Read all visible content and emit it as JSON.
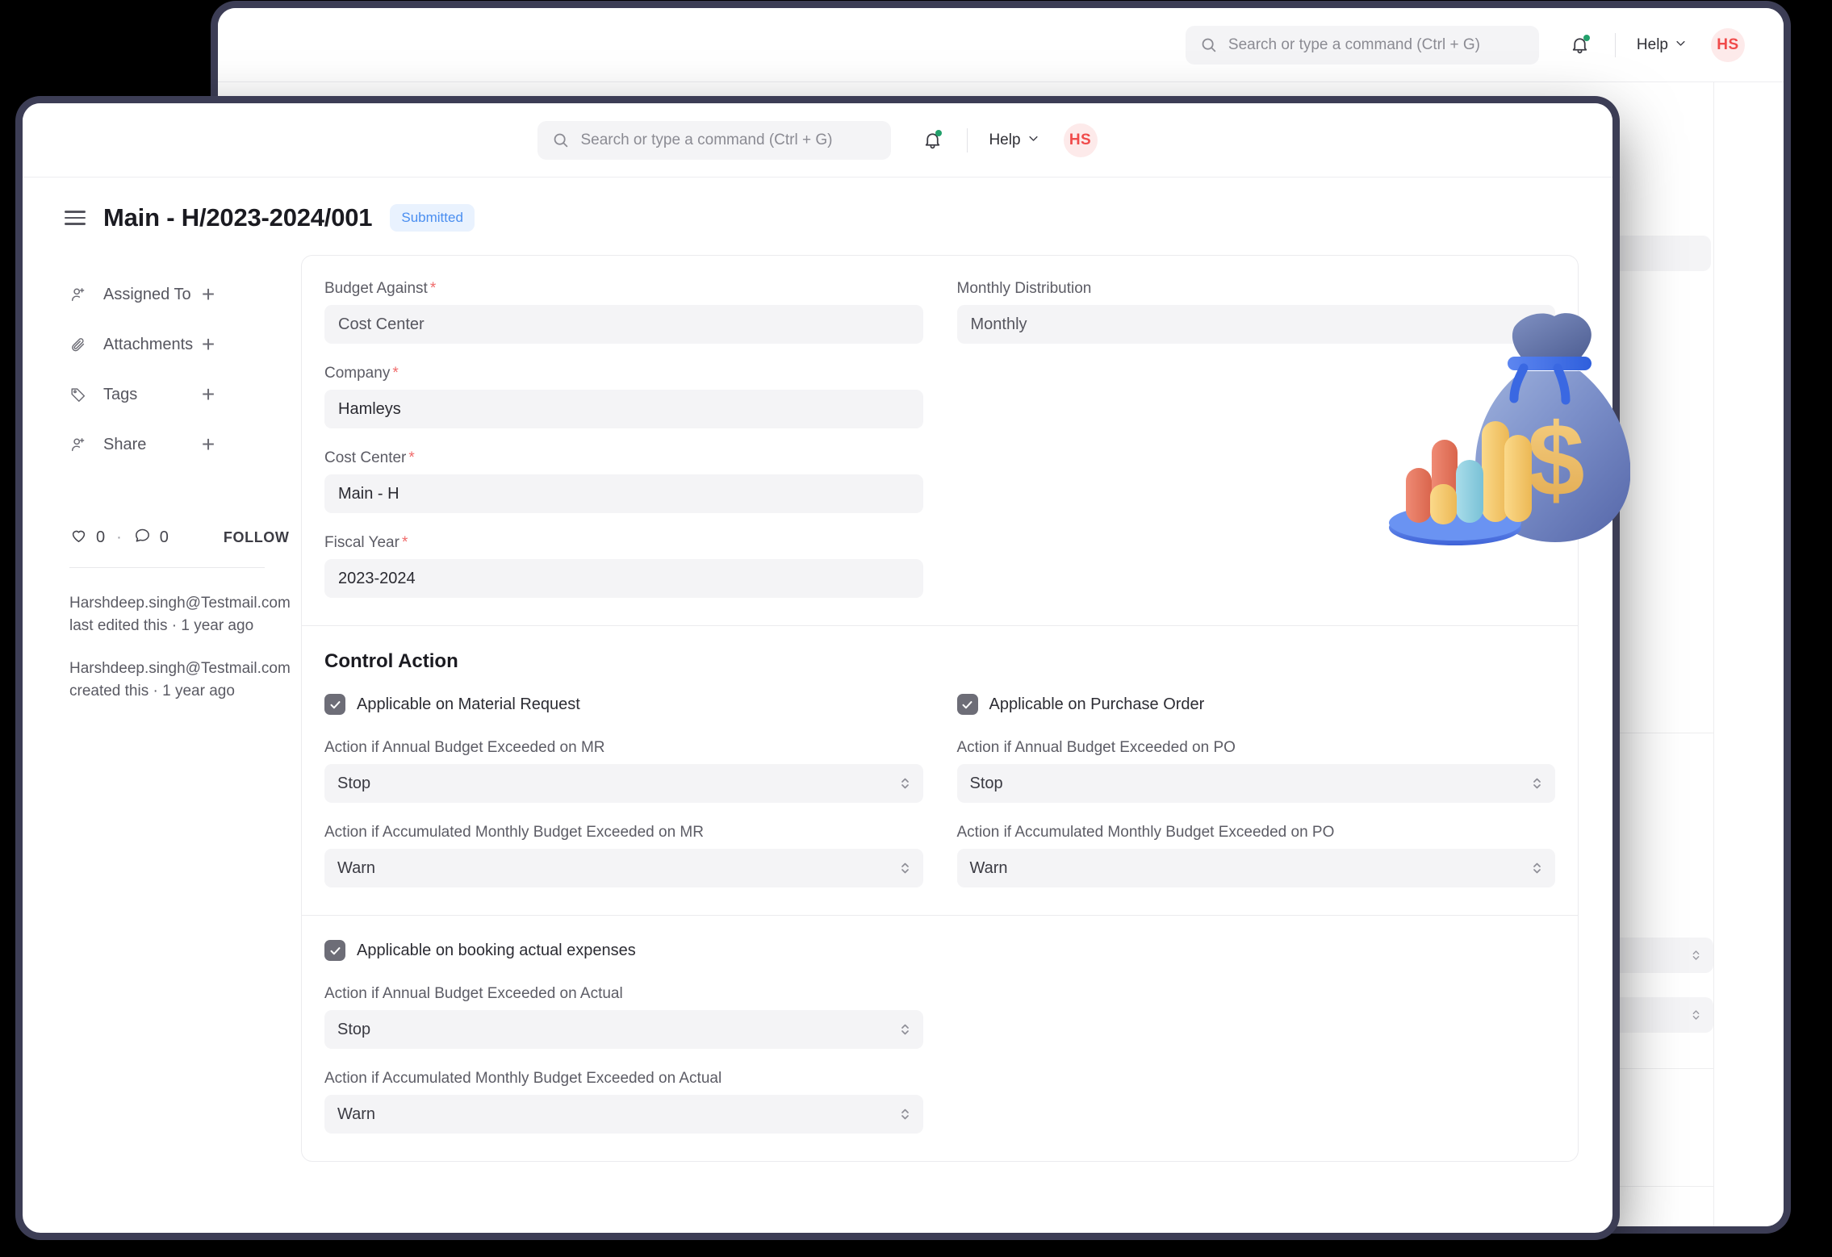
{
  "topbar": {
    "search_placeholder": "Search or type a command (Ctrl + G)",
    "help_label": "Help",
    "avatar_initials": "HS",
    "search_icon": "search-icon",
    "bell_icon": "notification-bell-icon",
    "chevron_icon": "chevron-down-icon"
  },
  "header": {
    "menu_icon": "hamburger-menu-icon",
    "title": "Main - H/2023-2024/001",
    "status": "Submitted",
    "status_color": "#4a8ef0",
    "status_bg": "#e9f2fe"
  },
  "sidebar": {
    "items": [
      {
        "label": "Assigned To",
        "icon": "assign-user-icon",
        "add": "+"
      },
      {
        "label": "Attachments",
        "icon": "paperclip-icon",
        "add": "+"
      },
      {
        "label": "Tags",
        "icon": "tag-icon",
        "add": "+"
      },
      {
        "label": "Share",
        "icon": "share-user-icon",
        "add": "+"
      }
    ],
    "likes_count": "0",
    "comments_count": "0",
    "separator": "·",
    "follow_label": "FOLLOW",
    "activity": [
      "Harshdeep.singh@Testmail.com last edited this · 1 year ago",
      "Harshdeep.singh@Testmail.com created this · 1 year ago"
    ]
  },
  "form": {
    "fields": [
      {
        "label": "Budget Against",
        "required": true,
        "value": "Cost Center",
        "muted": true
      },
      {
        "label": "Company",
        "required": true,
        "value": "Hamleys",
        "muted": false
      },
      {
        "label": "Cost Center",
        "required": true,
        "value": "Main - H",
        "muted": false
      },
      {
        "label": "Fiscal Year",
        "required": true,
        "value": "2023-2024",
        "muted": false
      }
    ],
    "right_fields": [
      {
        "label": "Monthly Distribution",
        "required": false,
        "value": "Monthly",
        "muted": true
      }
    ]
  },
  "control_action": {
    "section_title": "Control Action",
    "mr": {
      "checkbox_label": "Applicable on Material Request",
      "checked": true,
      "annual_label": "Action if Annual Budget Exceeded on MR",
      "annual_value": "Stop",
      "monthly_label": "Action if Accumulated Monthly Budget Exceeded on MR",
      "monthly_value": "Warn"
    },
    "po": {
      "checkbox_label": "Applicable on Purchase Order",
      "checked": true,
      "annual_label": "Action if Annual Budget Exceeded on PO",
      "annual_value": "Stop",
      "monthly_label": "Action if Accumulated Monthly Budget Exceeded on PO",
      "monthly_value": "Warn"
    },
    "actual": {
      "checkbox_label": "Applicable on booking actual expenses",
      "checked": true,
      "annual_label": "Action if Annual Budget Exceeded on Actual",
      "annual_value": "Stop",
      "monthly_label": "Action if Accumulated Monthly Budget Exceeded on Actual",
      "monthly_value": "Warn"
    }
  },
  "illustration": {
    "name": "money-bag-with-bar-chart-illustration",
    "currency_symbol": "$"
  }
}
